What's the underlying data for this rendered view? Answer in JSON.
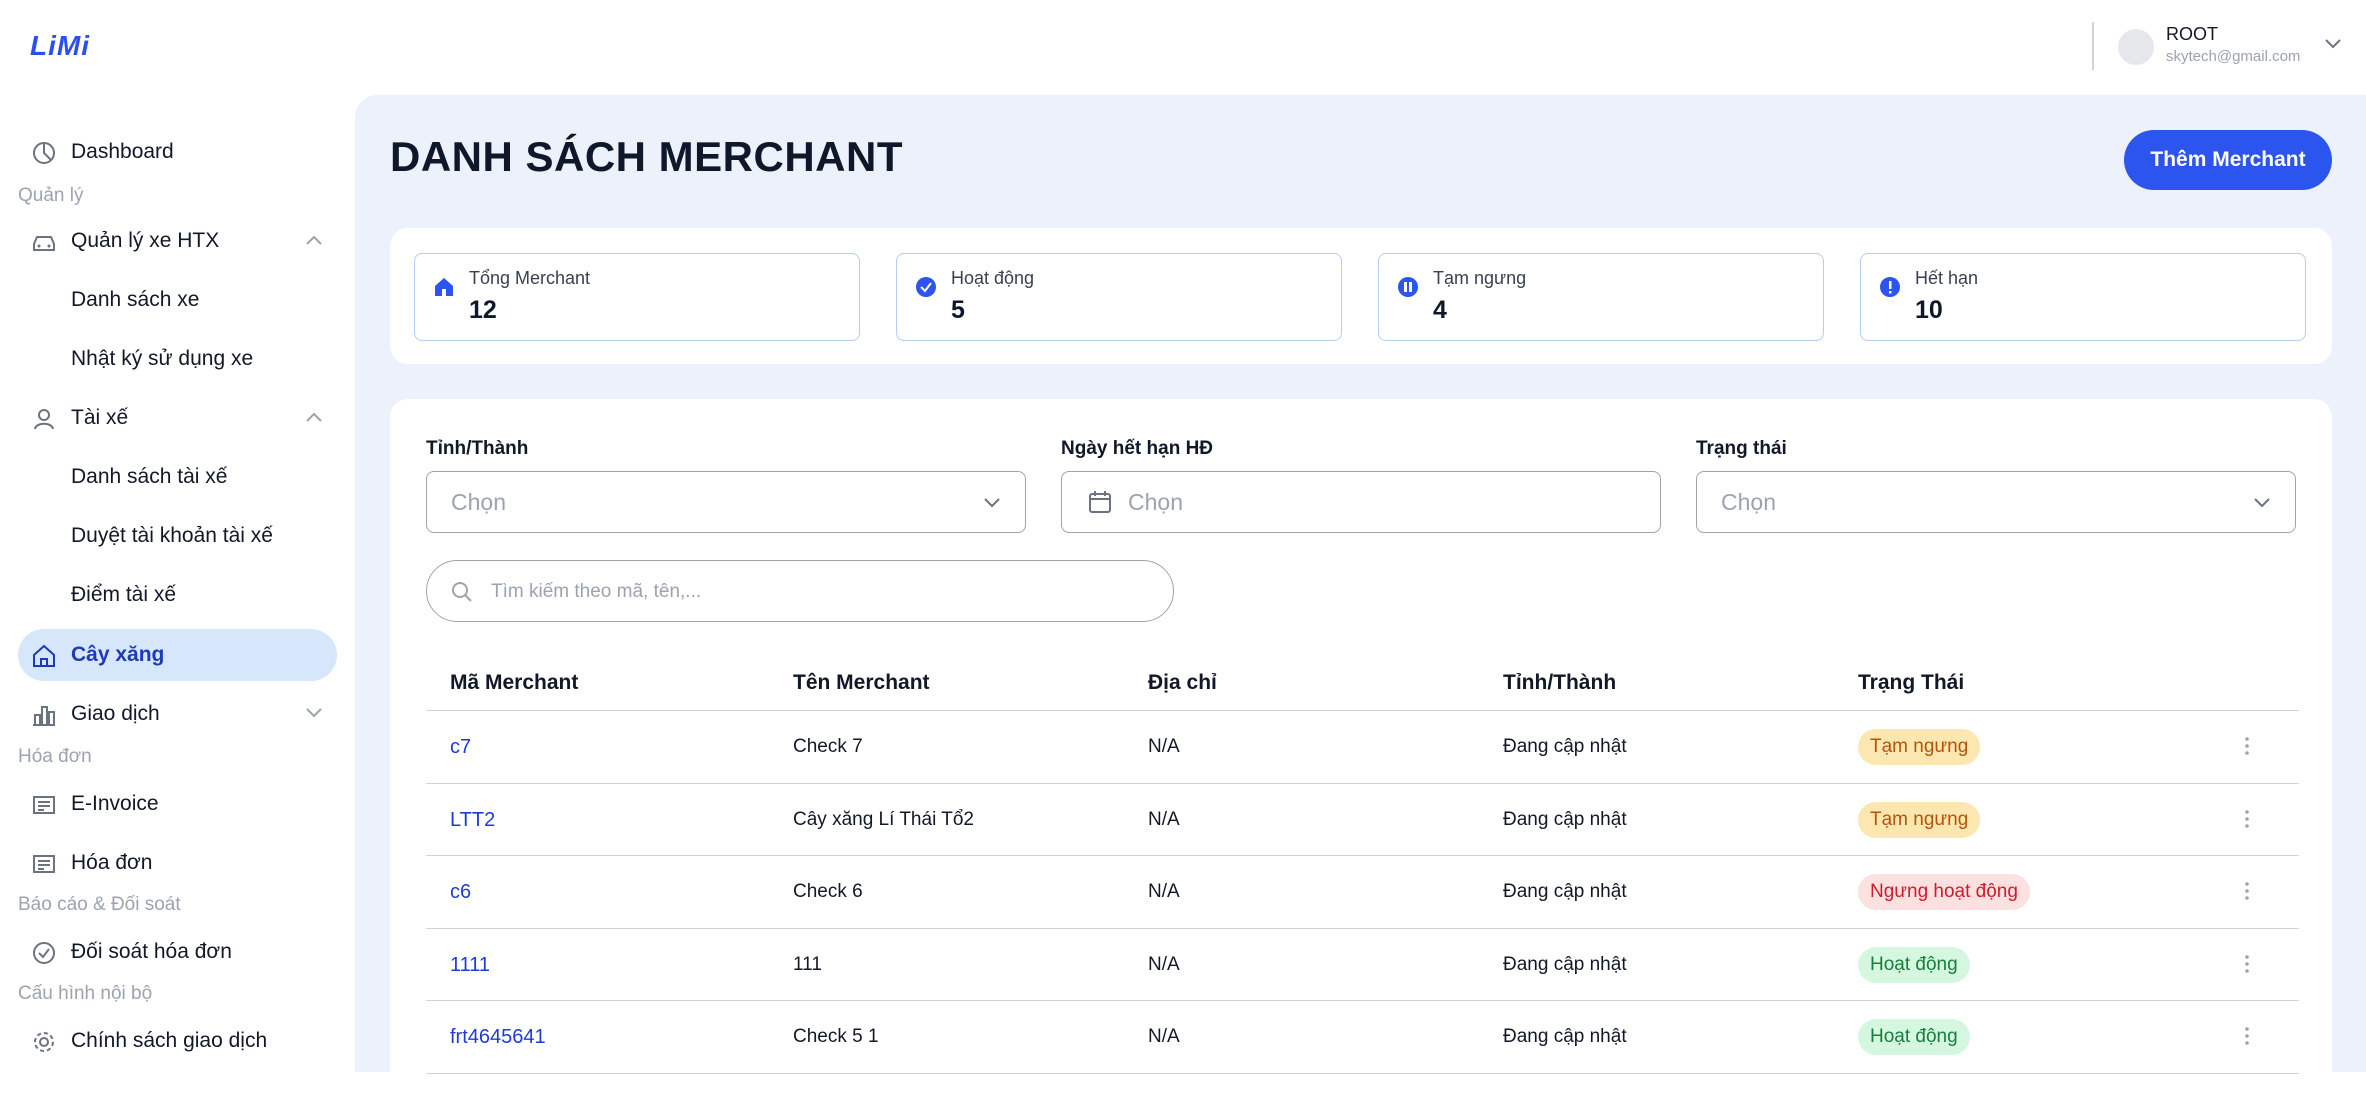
{
  "header": {
    "logo": "LiMi",
    "user": {
      "name": "ROOT",
      "email": "skytech@gmail.com"
    }
  },
  "sidebar": {
    "dashboard": "Dashboard",
    "sections": {
      "quan_ly": "Quản lý",
      "hoa_don": "Hóa đơn",
      "bao_cao": "Báo cáo & Đối soát",
      "cau_hinh": "Cấu hình nội bộ"
    },
    "items": {
      "quan_ly_xe": "Quản lý xe HTX",
      "danh_sach_xe": "Danh sách xe",
      "nhat_ky": "Nhật ký sử dụng xe",
      "tai_xe": "Tài xế",
      "danh_sach_tai_xe": "Danh sách tài xế",
      "duyet_tai_khoan": "Duyệt tài khoản tài xế",
      "diem_tai_xe": "Điểm tài xế",
      "cay_xang": "Cây xăng",
      "giao_dich": "Giao dịch",
      "einvoice": "E-Invoice",
      "hoa_don": "Hóa đơn",
      "doi_soat": "Đối soát hóa đơn",
      "chinh_sach": "Chính sách giao dịch"
    }
  },
  "main": {
    "title": "DANH SÁCH MERCHANT",
    "add_button": "Thêm Merchant",
    "stats": [
      {
        "label": "Tổng Merchant",
        "value": "12",
        "icon": "home-icon"
      },
      {
        "label": "Hoạt động",
        "value": "5",
        "icon": "verified-icon"
      },
      {
        "label": "Tạm ngưng",
        "value": "4",
        "icon": "pause-icon"
      },
      {
        "label": "Hết hạn",
        "value": "10",
        "icon": "alert-icon"
      }
    ],
    "filters": {
      "province": {
        "label": "Tỉnh/Thành",
        "placeholder": "Chọn"
      },
      "expiry": {
        "label": "Ngày hết hạn HĐ",
        "placeholder": "Chọn"
      },
      "status": {
        "label": "Trạng thái",
        "placeholder": "Chọn"
      }
    },
    "search_placeholder": "Tìm kiếm theo mã, tên,...",
    "table": {
      "headers": [
        "Mã Merchant",
        "Tên Merchant",
        "Địa chỉ",
        "Tỉnh/Thành",
        "Trạng Thái"
      ],
      "rows": [
        {
          "code": "c7",
          "name": "Check 7",
          "address": "N/A",
          "province": "Đang cập nhật",
          "status": "Tạm ngưng",
          "status_type": "warn"
        },
        {
          "code": "LTT2",
          "name": "Cây xăng Lí Thái Tổ2",
          "address": "N/A",
          "province": "Đang cập nhật",
          "status": "Tạm ngưng",
          "status_type": "warn"
        },
        {
          "code": "c6",
          "name": "Check 6",
          "address": "N/A",
          "province": "Đang cập nhật",
          "status": "Ngưng hoạt động",
          "status_type": "danger"
        },
        {
          "code": "1111",
          "name": "111",
          "address": "N/A",
          "province": "Đang cập nhật",
          "status": "Hoạt động",
          "status_type": "ok"
        },
        {
          "code": "frt4645641",
          "name": "Check 5 1",
          "address": "N/A",
          "province": "Đang cập nhật",
          "status": "Hoạt động",
          "status_type": "ok"
        }
      ]
    }
  },
  "colors": {
    "accent": "#2b55ee",
    "main_bg": "#edf1fb",
    "active_nav": "#d6e6fb",
    "warn_bg": "#fde7b0",
    "danger_bg": "#fde0e0",
    "ok_bg": "#d5f7e0"
  }
}
